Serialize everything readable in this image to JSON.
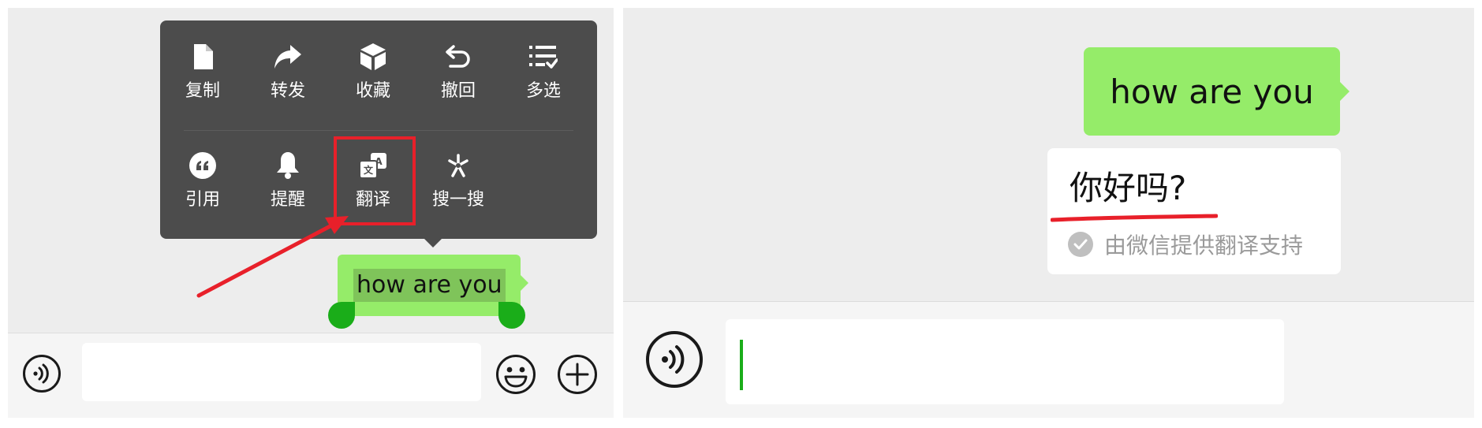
{
  "menu": {
    "row1": [
      {
        "label": "复制",
        "icon": "document-icon"
      },
      {
        "label": "转发",
        "icon": "forward-arrow-icon"
      },
      {
        "label": "收藏",
        "icon": "cube-icon"
      },
      {
        "label": "撤回",
        "icon": "undo-icon"
      },
      {
        "label": "多选",
        "icon": "multi-select-list-icon"
      }
    ],
    "row2": [
      {
        "label": "引用",
        "icon": "quote-icon"
      },
      {
        "label": "提醒",
        "icon": "bell-icon"
      },
      {
        "label": "翻译",
        "icon": "translate-icon"
      },
      {
        "label": "搜一搜",
        "icon": "search-sparkle-icon"
      }
    ]
  },
  "left": {
    "message": "how are you"
  },
  "right": {
    "message": "how are you",
    "translation": "你好吗?",
    "provider": "由微信提供翻译支持"
  },
  "colors": {
    "bubble_green": "#95ec69",
    "menu_bg": "#4c4c4c",
    "annotation_red": "#e8202a",
    "caret_green": "#1aad19"
  }
}
